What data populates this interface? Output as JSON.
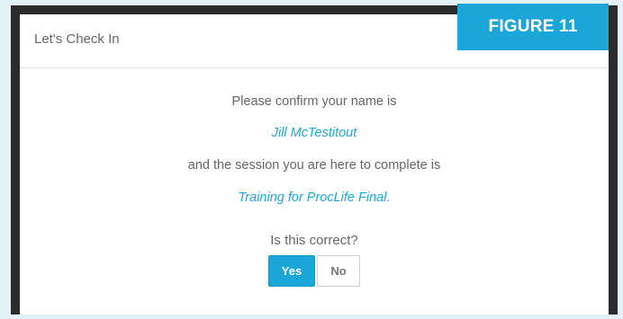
{
  "modal": {
    "title": "Let's Check In",
    "figure_label": "FIGURE 11"
  },
  "confirmation": {
    "intro": "Please confirm your name is",
    "name": "Jill McTestitout",
    "session_intro": "and the session you are here to complete is",
    "session": "Training for ProcLife Final.",
    "question": "Is this correct?"
  },
  "buttons": {
    "yes_label": "Yes",
    "no_label": "No"
  },
  "colors": {
    "accent": "#1aa6d6",
    "text": "#666666",
    "frame": "#2b2b2b"
  }
}
